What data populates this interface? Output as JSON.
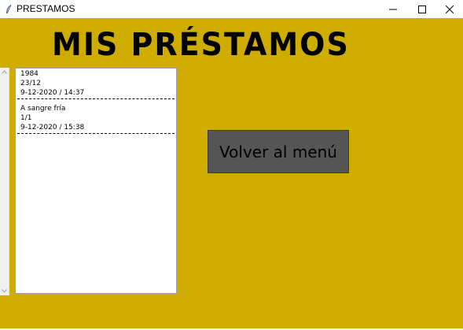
{
  "window": {
    "title": "PRESTAMOS",
    "icon": "feather-icon",
    "controls": {
      "minimize": "minimize-icon",
      "maximize": "maximize-icon",
      "close": "close-icon"
    }
  },
  "colors": {
    "background": "#cfad00",
    "button": "#555555",
    "panel": "#ffffff"
  },
  "heading": {
    "text": "MIS PRÉSTAMOS"
  },
  "loans": {
    "items": [
      {
        "title": "1984",
        "due": "23/12",
        "loaned": "9-12-2020 / 14:37"
      },
      {
        "title": "A sangre fría",
        "due": "1/1",
        "loaned": "9-12-2020 / 15:38"
      }
    ]
  },
  "actions": {
    "back_label": "Volver al menú"
  }
}
